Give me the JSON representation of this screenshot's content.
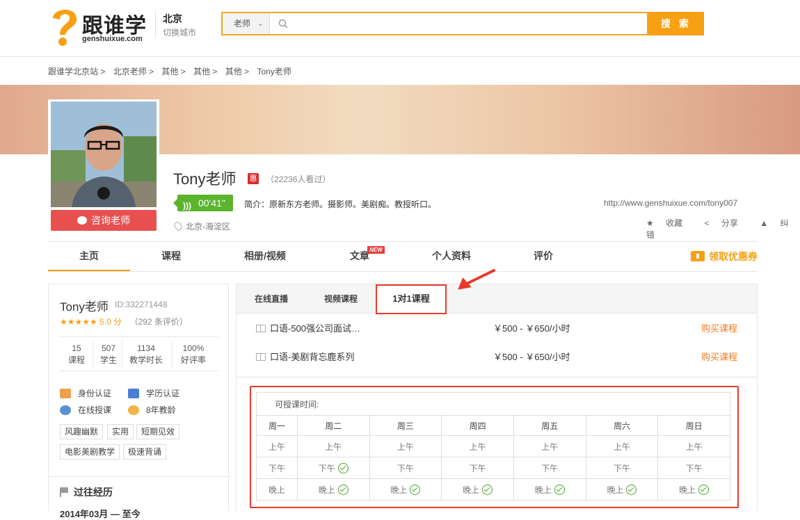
{
  "header": {
    "logo_text": "跟谁学",
    "logo_sub": "genshuixue.com",
    "city": "北京",
    "city_switch": "切换城市",
    "search_category": "老师",
    "search_placeholder": "",
    "search_button": "搜 索"
  },
  "breadcrumb": [
    "跟谁学北京站 >",
    "北京老师 >",
    "其他 >",
    "其他 >",
    "其他 >",
    "Tony老师"
  ],
  "profile": {
    "name": "Tony老师",
    "badge": "惠",
    "views": "（22236人看过）",
    "audio_duration": "00'41\"",
    "intro": "简介：原新东方老师。摄影师。美剧痴。教授听口。",
    "url": "http://www.genshuixue.com/tony007",
    "location": "北京-海淀区",
    "consult_button": "咨询老师",
    "actions": {
      "favorite": "收藏",
      "share": "分享",
      "report": "纠错"
    }
  },
  "nav": {
    "tabs": [
      "主页",
      "课程",
      "相册/视频",
      "文章",
      "个人资料",
      "评价"
    ],
    "new_badge": "NEW",
    "coupon": "领取优惠券"
  },
  "sidebar": {
    "name": "Tony老师",
    "id": "ID:332271448",
    "stars": "★★★★★",
    "score": "5.0 分",
    "reviews": "（292 条评价）",
    "stats": [
      {
        "value": "15",
        "label": "课程"
      },
      {
        "value": "507",
        "label": "学生"
      },
      {
        "value": "1134",
        "label": "教学时长"
      },
      {
        "value": "100%",
        "label": "好评率"
      }
    ],
    "certs": [
      "身份认证",
      "学历认证",
      "在线授课",
      "8年教龄"
    ],
    "tags": [
      "风趣幽默",
      "实用",
      "短期见效",
      "电影美剧教学",
      "极速背诵"
    ],
    "past_title": "过往经历",
    "past_date": "2014年03月 — 至今"
  },
  "panel": {
    "sub_tabs": [
      "在线直播",
      "视频课程",
      "1对1课程"
    ],
    "courses": [
      {
        "title": "口语-500强公司面试…",
        "price": "￥500 - ￥650/小时",
        "buy": "购买课程"
      },
      {
        "title": "口语-美剧背忘鹿系列",
        "price": "￥500 - ￥650/小时",
        "buy": "购买课程"
      }
    ],
    "schedule": {
      "title": "可授课时间:",
      "days": [
        "周一",
        "周二",
        "周三",
        "周四",
        "周五",
        "周六",
        "周日"
      ],
      "slots": [
        "上午",
        "下午",
        "晚上"
      ],
      "available": {
        "上午": [
          false,
          false,
          false,
          false,
          false,
          false,
          false
        ],
        "下午": [
          false,
          true,
          false,
          false,
          false,
          false,
          false
        ],
        "晚上": [
          false,
          true,
          true,
          true,
          true,
          true,
          true
        ]
      }
    }
  },
  "colors": {
    "accent": "#f7a013",
    "highlight": "#e8392b",
    "consult": "#e85050",
    "audio": "#5bb32e"
  }
}
